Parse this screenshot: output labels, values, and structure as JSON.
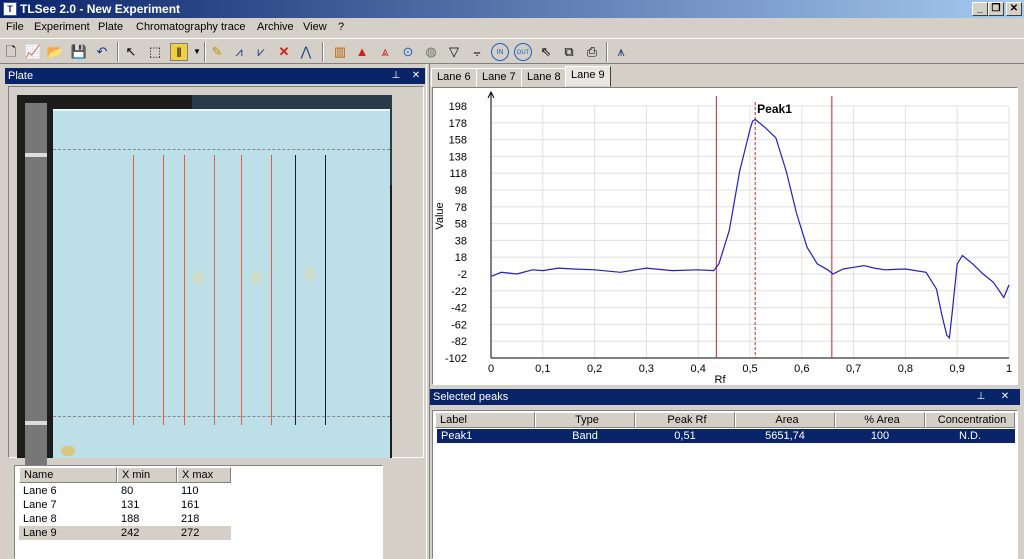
{
  "window": {
    "title": "TLSee 2.0 - New Experiment",
    "controls": [
      "_",
      "❐",
      "✕"
    ]
  },
  "menu": [
    "File",
    "Experiment",
    "Plate",
    "Chromatography trace",
    "Archive",
    "View",
    "?"
  ],
  "toolbar": {
    "icons": [
      "new-file-icon",
      "chart-icon",
      "open-folder-icon",
      "save-icon",
      "undo-icon",
      "select-arrow-icon",
      "select-region-icon",
      "lanes-icon",
      "dropdown-icon",
      "pencil-icon",
      "peak-left-icon",
      "peak-right-icon",
      "delete-icon",
      "peak-shape-icon",
      "bar-chart-icon",
      "peak-red-icon",
      "peaks-red-icon",
      "zoom-icon",
      "circle-icon",
      "filter-icon",
      "baseline-icon",
      "zoom-in-icon",
      "zoom-out-icon",
      "pointer-icon",
      "copy-icon",
      "print-icon",
      "spectrum-icon"
    ],
    "zoom_in_label": "IN",
    "zoom_out_label": "OUT"
  },
  "plate_panel": {
    "title": "Plate",
    "pin": "⊥",
    "close": "✕"
  },
  "lanes_table": {
    "headers": [
      "Name",
      "X min",
      "X max"
    ],
    "rows": [
      {
        "name": "Lane 6",
        "xmin": "80",
        "xmax": "110"
      },
      {
        "name": "Lane 7",
        "xmin": "131",
        "xmax": "161"
      },
      {
        "name": "Lane 8",
        "xmin": "188",
        "xmax": "218"
      },
      {
        "name": "Lane 9",
        "xmin": "242",
        "xmax": "272"
      }
    ],
    "selected_index": 3
  },
  "tabs": [
    "Lane 6",
    "Lane 7",
    "Lane 8",
    "Lane 9"
  ],
  "active_tab": 3,
  "chart_data": {
    "type": "line",
    "xlabel": "Rf",
    "ylabel": "Value",
    "xlim": [
      0,
      1
    ],
    "ylim": [
      -102,
      198
    ],
    "x_ticks": [
      "0",
      "0,1",
      "0,2",
      "0,3",
      "0,4",
      "0,5",
      "0,6",
      "0,7",
      "0,8",
      "0,9",
      "1"
    ],
    "y_ticks": [
      "198",
      "178",
      "158",
      "138",
      "118",
      "98",
      "78",
      "58",
      "38",
      "18",
      "-2",
      "-22",
      "-42",
      "-62",
      "-82",
      "-102"
    ],
    "peak_label": "Peak1",
    "peak_bounds": [
      0.435,
      0.658
    ],
    "peak_center": 0.51,
    "series": [
      {
        "color": "#2020c0",
        "x": [
          0,
          0.02,
          0.05,
          0.08,
          0.1,
          0.13,
          0.16,
          0.2,
          0.25,
          0.3,
          0.35,
          0.4,
          0.43,
          0.44,
          0.46,
          0.48,
          0.5,
          0.505,
          0.51,
          0.53,
          0.55,
          0.57,
          0.59,
          0.61,
          0.63,
          0.65,
          0.66,
          0.68,
          0.7,
          0.72,
          0.74,
          0.76,
          0.8,
          0.84,
          0.86,
          0.87,
          0.88,
          0.885,
          0.89,
          0.9,
          0.91,
          0.93,
          0.95,
          0.97,
          0.99,
          1.0
        ],
        "y": [
          -5,
          0,
          -2,
          3,
          2,
          5,
          4,
          3,
          0,
          5,
          2,
          3,
          2,
          10,
          50,
          120,
          170,
          180,
          182,
          172,
          160,
          120,
          70,
          30,
          10,
          3,
          -2,
          4,
          6,
          8,
          5,
          3,
          4,
          0,
          -20,
          -50,
          -75,
          -78,
          -50,
          10,
          20,
          10,
          -2,
          -12,
          -30,
          -15
        ]
      }
    ]
  },
  "peaks_panel": {
    "title": "Selected peaks",
    "pin": "⊥",
    "close": "✕",
    "headers": [
      "Label",
      "Type",
      "Peak Rf",
      "Area",
      "% Area",
      "Concentration"
    ],
    "rows": [
      {
        "label": "Peak1",
        "type": "Band",
        "rf": "0,51",
        "area": "5651,74",
        "pct": "100",
        "conc": "N.D."
      }
    ]
  }
}
